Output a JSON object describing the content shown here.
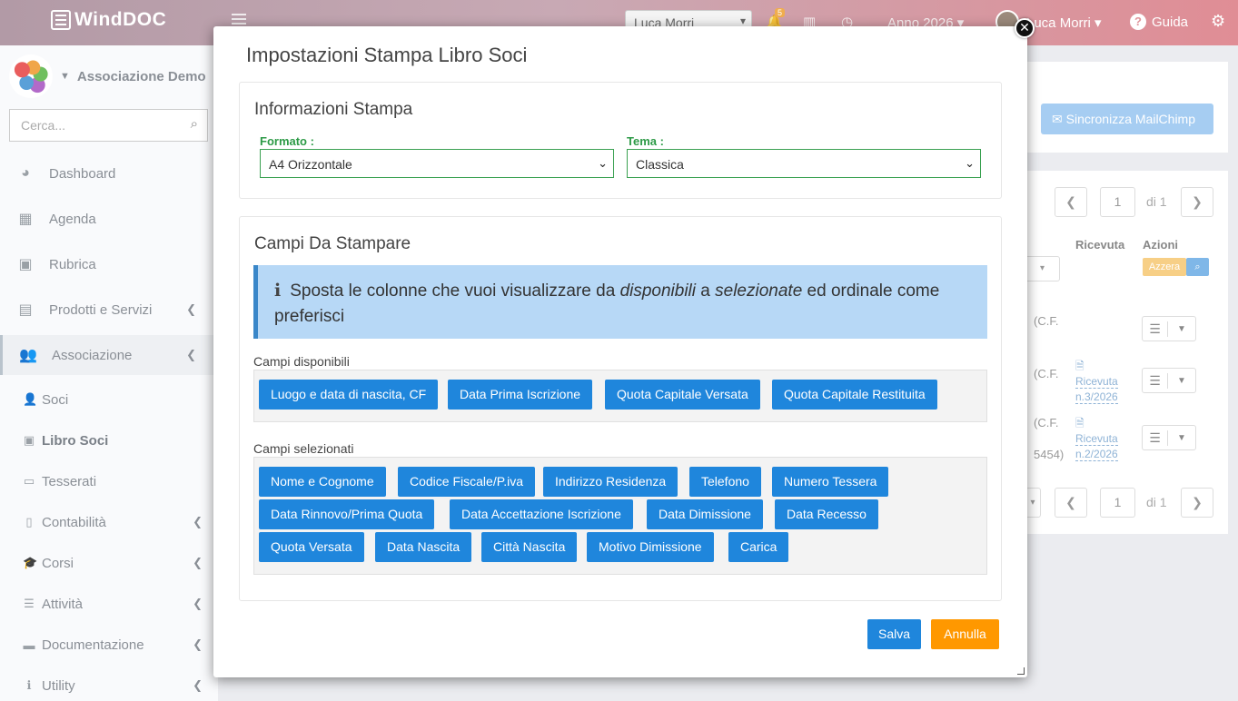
{
  "app": {
    "logo": "WindDOC"
  },
  "topbar": {
    "user_select": "Luca Morri",
    "notif_count": "5",
    "year": "Anno 2026",
    "user": "Luca Morri",
    "help": "Guida"
  },
  "sidebar": {
    "org_name": "Associazione Demo",
    "search_placeholder": "Cerca...",
    "items": [
      {
        "label": "Dashboard"
      },
      {
        "label": "Agenda"
      },
      {
        "label": "Rubrica"
      },
      {
        "label": "Prodotti e Servizi"
      },
      {
        "label": "Associazione"
      }
    ],
    "sub_items": [
      {
        "label": "Soci"
      },
      {
        "label": "Libro Soci"
      },
      {
        "label": "Tesserati"
      },
      {
        "label": "Contabilità"
      },
      {
        "label": "Corsi"
      },
      {
        "label": "Attività"
      },
      {
        "label": "Documentazione"
      },
      {
        "label": "Utility"
      }
    ]
  },
  "background": {
    "mailchimp": "Sincronizza MailChimp",
    "page_current": "1",
    "page_total": "di 1",
    "col_ricevuta": "Ricevuta",
    "col_azioni": "Azioni",
    "azzera": "Azzera",
    "row_cf": "(C.F.",
    "row_tail": "5454)",
    "ricevuta_1_a": "Ricevuta",
    "ricevuta_1_b": "n.3/2026",
    "ricevuta_2_a": "Ricevuta",
    "ricevuta_2_b": "n.2/2026"
  },
  "modal": {
    "title": "Impostazioni Stampa Libro Soci",
    "print_info": {
      "title": "Informazioni Stampa",
      "formato_label": "Formato :",
      "formato_value": "A4 Orizzontale",
      "tema_label": "Tema :",
      "tema_value": "Classica"
    },
    "fields": {
      "title": "Campi Da Stampare",
      "info_pre": "Sposta le colonne che vuoi visualizzare da ",
      "info_em1": "disponibili",
      "info_mid": " a ",
      "info_em2": "selezionate",
      "info_post": " ed ordinale come preferisci",
      "available_label": "Campi disponibili",
      "available": [
        "Luogo e data di nascita, CF",
        "Data Prima Iscrizione",
        "Quota Capitale Versata",
        "Quota Capitale Restituita"
      ],
      "selected_label": "Campi selezionati",
      "selected": [
        "Nome e Cognome",
        "Codice Fiscale/P.iva",
        "Indirizzo Residenza",
        "Telefono",
        "Numero Tessera",
        "Data Rinnovo/Prima Quota",
        "Data Accettazione Iscrizione",
        "Data Dimissione",
        "Data Recesso",
        "Quota Versata",
        "Data Nascita",
        "Città Nascita",
        "Motivo Dimissione",
        "Carica"
      ]
    },
    "save_label": "Salva",
    "cancel_label": "Annulla"
  },
  "colors": {
    "primary": "#1f86dc",
    "warning": "#ff9800",
    "label_green": "#2c9a46",
    "info_bg": "#b7d8f6"
  }
}
